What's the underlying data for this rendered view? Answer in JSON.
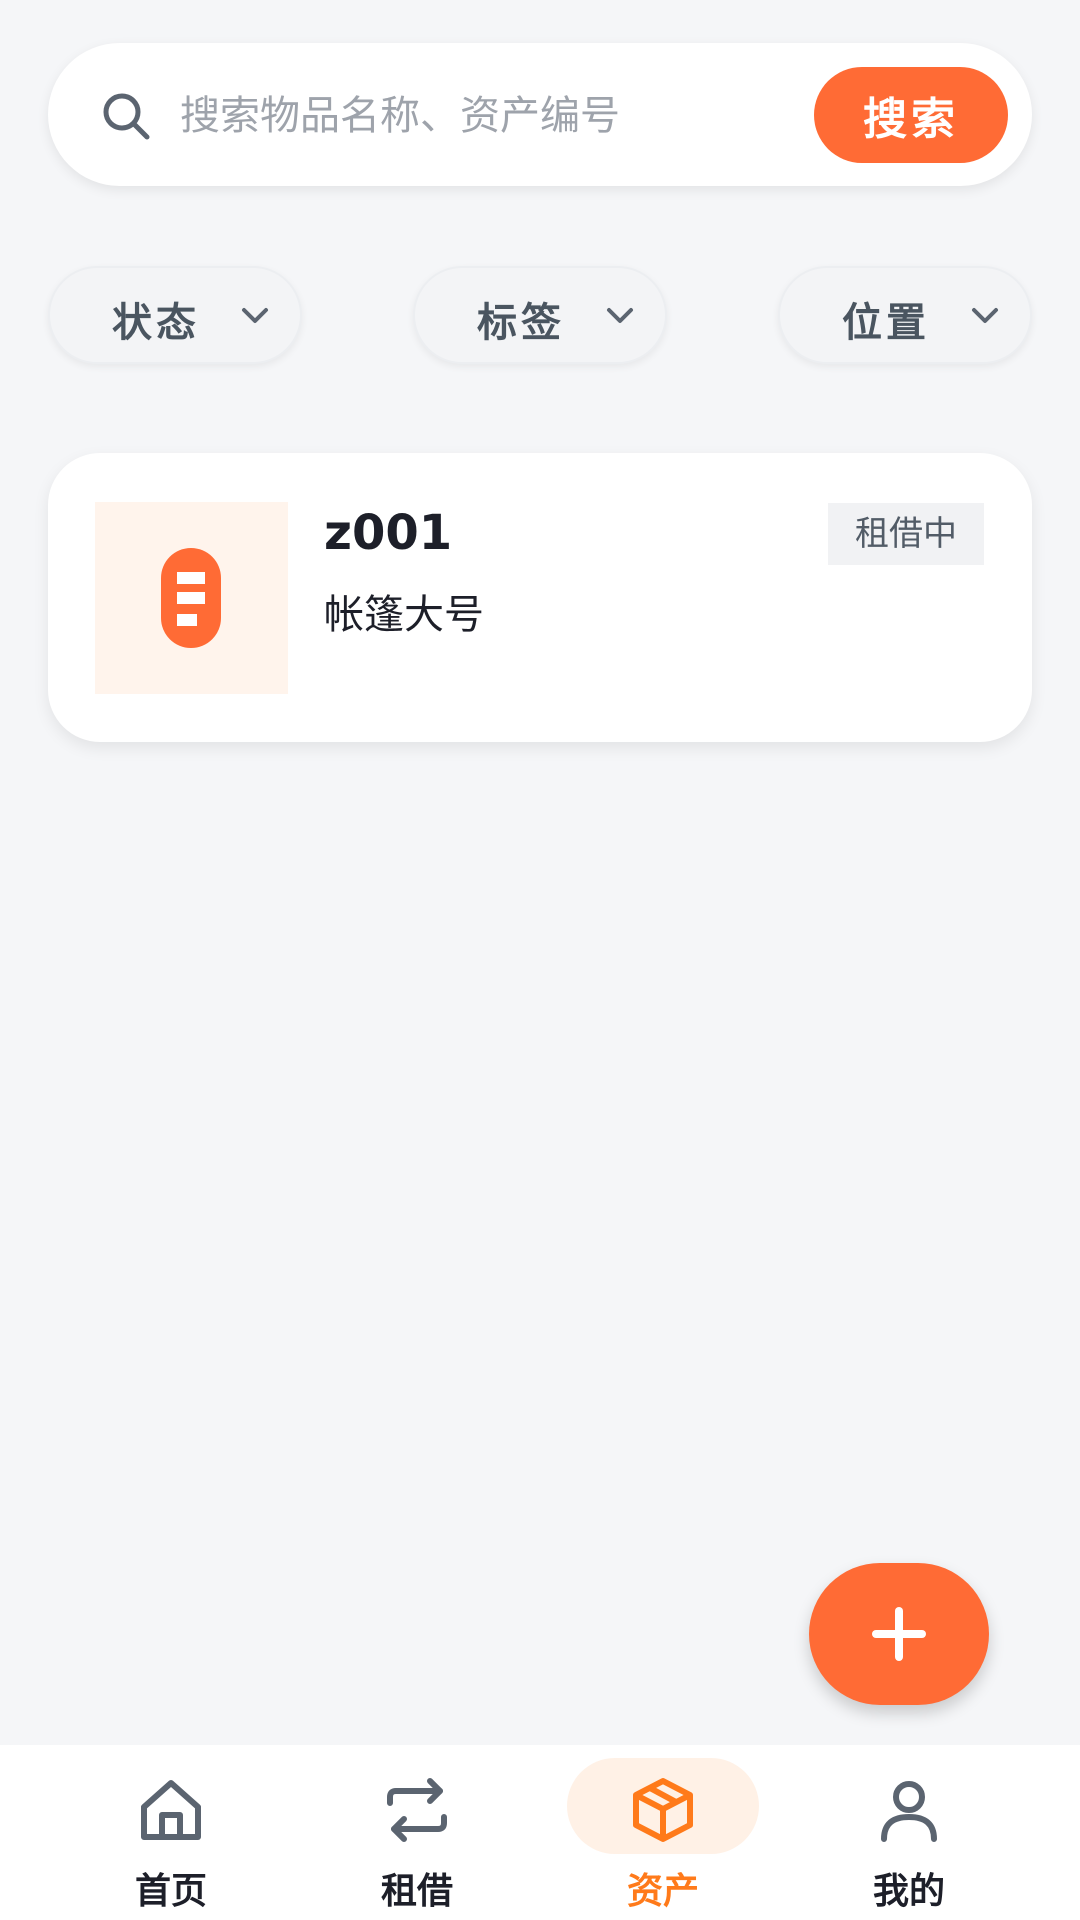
{
  "search": {
    "placeholder": "搜索物品名称、资产编号",
    "button_label": "搜索"
  },
  "filters": [
    {
      "label": "状态"
    },
    {
      "label": "标签"
    },
    {
      "label": "位置"
    }
  ],
  "assets": [
    {
      "code": "z001",
      "name": "帐篷大号",
      "status": "租借中"
    }
  ],
  "fab": {
    "icon": "plus-icon"
  },
  "nav": {
    "items": [
      {
        "label": "首页",
        "icon": "home-icon"
      },
      {
        "label": "租借",
        "icon": "swap-icon"
      },
      {
        "label": "资产",
        "icon": "box-icon",
        "active": true
      },
      {
        "label": "我的",
        "icon": "user-icon"
      }
    ]
  },
  "colors": {
    "accent": "#ff6b35",
    "active_nav": "#ff7a1a",
    "background": "#f5f6f8"
  }
}
